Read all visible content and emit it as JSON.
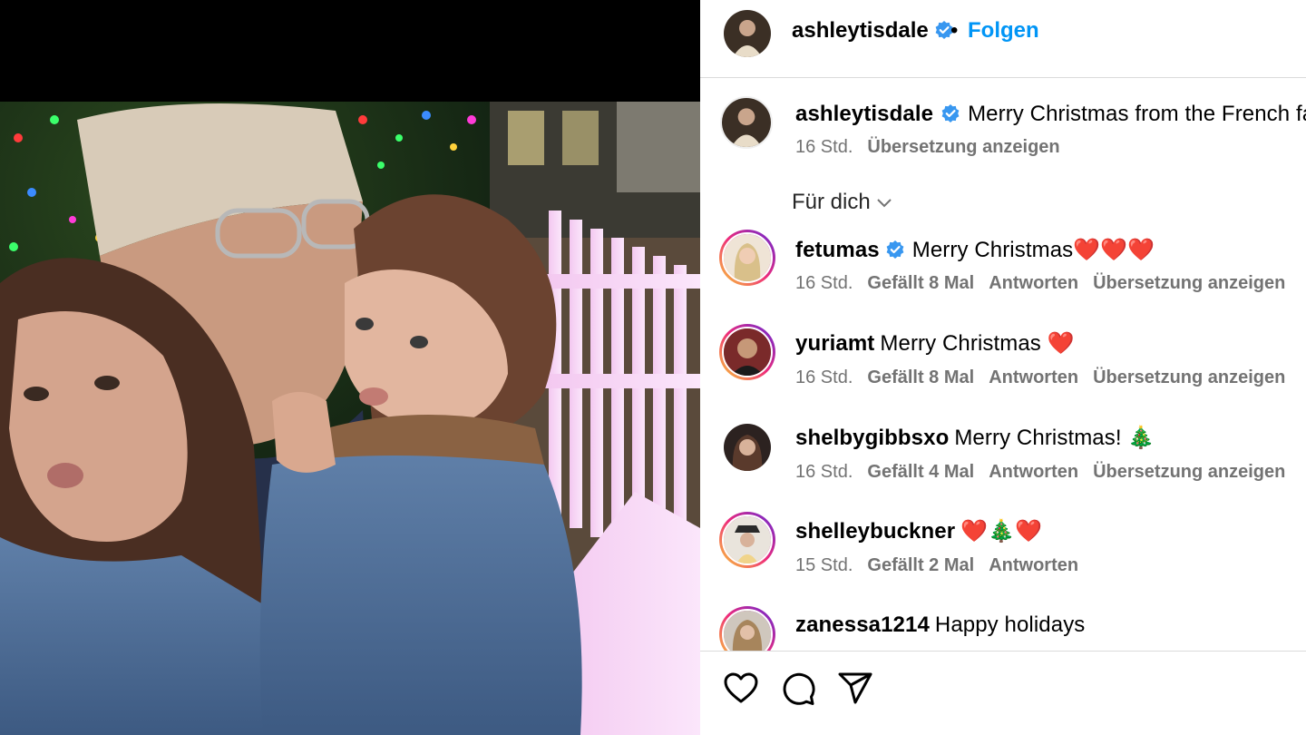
{
  "post": {
    "author": "ashleytisdale",
    "follow_label": "Folgen",
    "separator": "•",
    "caption": "Merry Christmas from the French family",
    "caption_time": "16 Std.",
    "caption_translate": "Übersetzung anzeigen"
  },
  "filter": {
    "label": "Für dich"
  },
  "comments": [
    {
      "user": "fetumas",
      "verified": true,
      "text": "Merry Christmas❤️❤️❤️",
      "time": "16 Std.",
      "likes": "Gefällt 8 Mal",
      "reply": "Antworten",
      "translate": "Übersetzung anzeigen"
    },
    {
      "user": "yuriamt",
      "verified": false,
      "text": "Merry Christmas ❤️",
      "time": "16 Std.",
      "likes": "Gefällt 8 Mal",
      "reply": "Antworten",
      "translate": "Übersetzung anzeigen"
    },
    {
      "user": "shelbygibbsxo",
      "verified": false,
      "text": "Merry Christmas! 🎄",
      "time": "16 Std.",
      "likes": "Gefällt 4 Mal",
      "reply": "Antworten",
      "translate": "Übersetzung anzeigen"
    },
    {
      "user": "shelleybuckner",
      "verified": false,
      "text": "❤️🎄❤️",
      "time": "15 Std.",
      "likes": "Gefällt 2 Mal",
      "reply": "Antworten",
      "translate": ""
    },
    {
      "user": "zanessa1214",
      "verified": false,
      "text": "Happy holidays",
      "time": "",
      "likes": "",
      "reply": "",
      "translate": ""
    }
  ],
  "action_bar": {
    "icons": [
      "heart-icon",
      "comment-icon",
      "share-icon"
    ]
  },
  "colors": {
    "link_blue": "#0095f6",
    "meta_gray": "#737373",
    "verified_blue": "#3897f0",
    "divider": "#dbdbdb"
  }
}
